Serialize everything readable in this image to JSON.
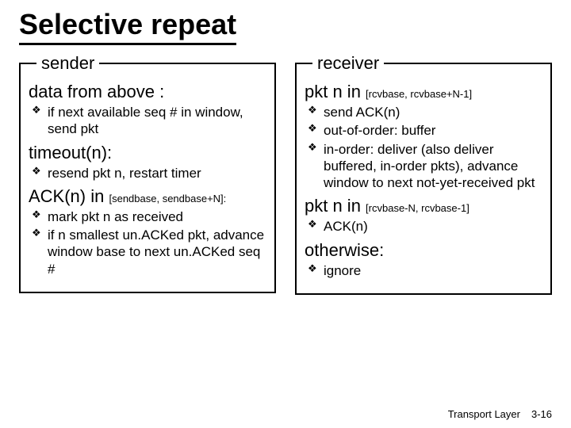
{
  "title": "Selective repeat",
  "sender": {
    "legend": "sender",
    "sections": [
      {
        "heading": "data from above :",
        "heading_sub": "",
        "bullets": [
          "if next available seq # in window, send pkt"
        ]
      },
      {
        "heading": "timeout(n):",
        "heading_sub": "",
        "bullets": [
          "resend pkt n, restart timer"
        ]
      },
      {
        "heading": "ACK(n) in ",
        "heading_sub": "[sendbase, sendbase+N]:",
        "bullets": [
          "mark pkt n as received",
          "if n smallest un.ACKed pkt, advance window base to next un.ACKed seq #"
        ]
      }
    ]
  },
  "receiver": {
    "legend": "receiver",
    "sections": [
      {
        "heading": "pkt n in ",
        "heading_sub": "[rcvbase, rcvbase+N-1]",
        "bullets": [
          "send ACK(n)",
          "out-of-order: buffer",
          "in-order: deliver (also deliver buffered, in-order pkts), advance window to next not-yet-received pkt"
        ]
      },
      {
        "heading": "pkt n in ",
        "heading_sub": "[rcvbase-N, rcvbase-1]",
        "bullets": [
          "ACK(n)"
        ]
      },
      {
        "heading": "otherwise:",
        "heading_sub": "",
        "bullets": [
          "ignore"
        ]
      }
    ]
  },
  "footer": {
    "label": "Transport Layer",
    "page": "3-16"
  }
}
